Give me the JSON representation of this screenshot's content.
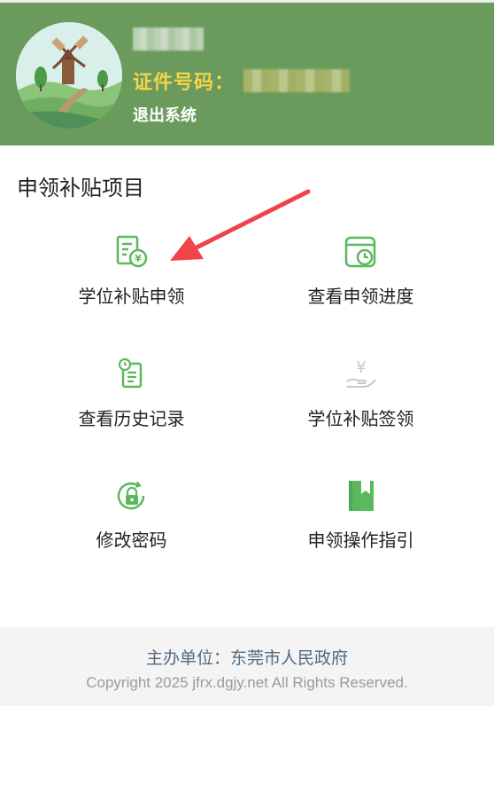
{
  "header": {
    "id_label": "证件号码：",
    "logout_label": "退出系统"
  },
  "section": {
    "title": "申领补贴项目"
  },
  "menu": [
    {
      "label": "学位补贴申领",
      "icon": "subsidy-document-icon"
    },
    {
      "label": "查看申领进度",
      "icon": "calendar-clock-icon"
    },
    {
      "label": "查看历史记录",
      "icon": "history-clipboard-icon"
    },
    {
      "label": "学位补贴签领",
      "icon": "yuan-hand-icon"
    },
    {
      "label": "修改密码",
      "icon": "lock-refresh-icon"
    },
    {
      "label": "申领操作指引",
      "icon": "bookmark-book-icon"
    }
  ],
  "footer": {
    "org": "主办单位：东莞市人民政府",
    "copyright": "Copyright 2025 jfrx.dgjy.net All Rights Reserved."
  },
  "colors": {
    "header_bg": "#6a9b5c",
    "id_label": "#f5d34a",
    "icon_green": "#5cb85c",
    "arrow_red": "#f0434a"
  }
}
